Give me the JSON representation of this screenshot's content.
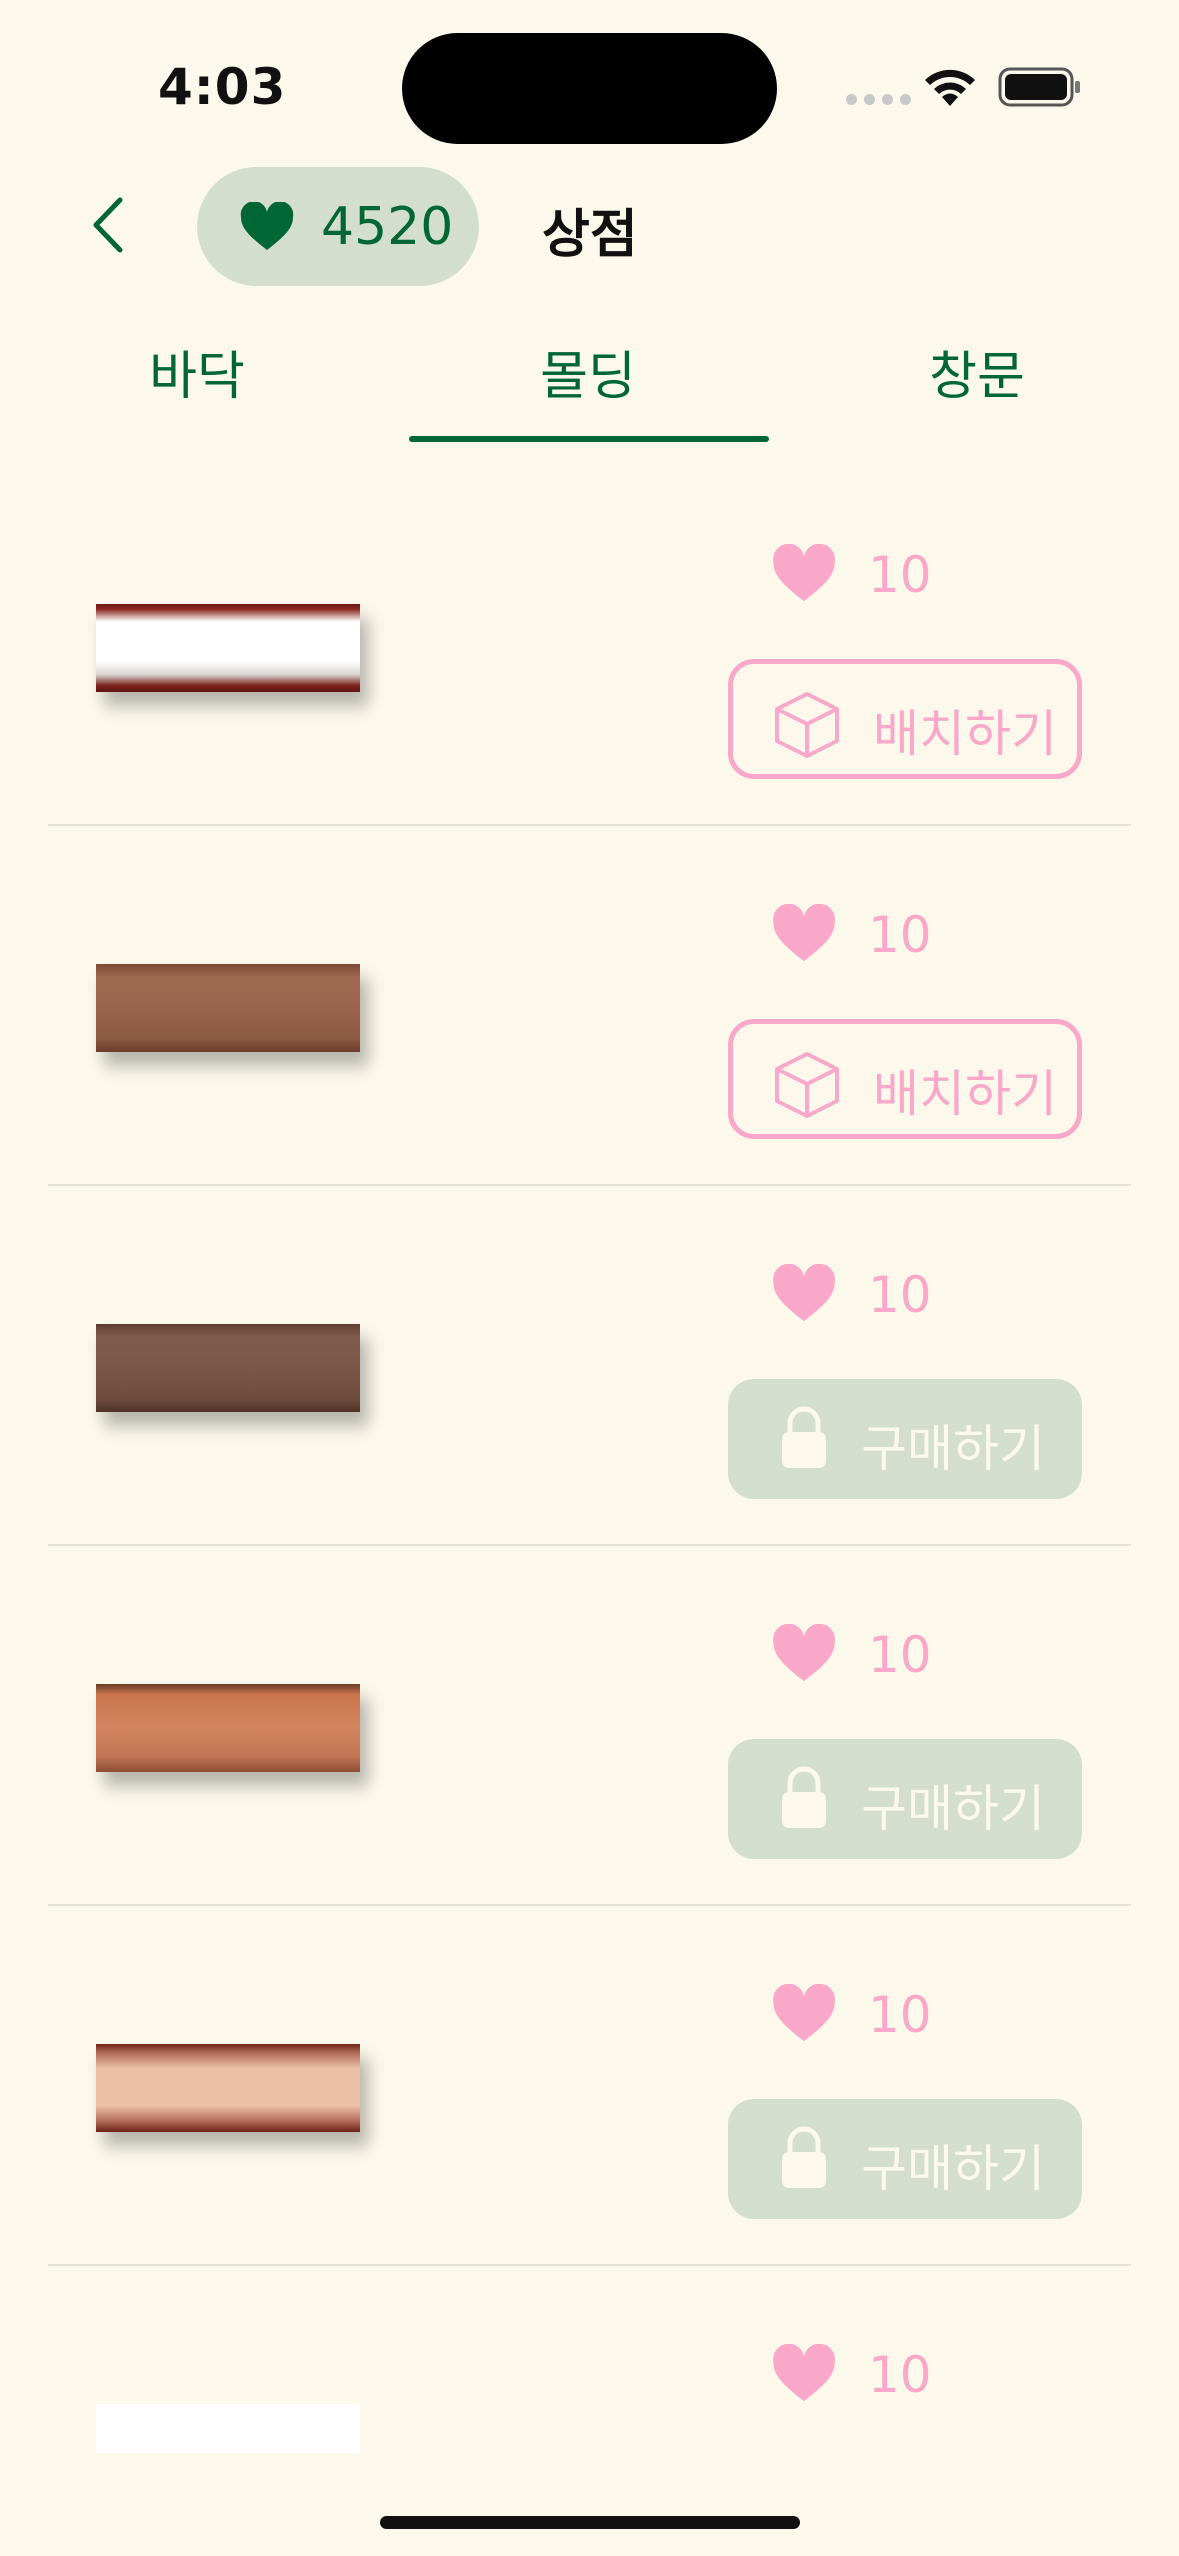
{
  "status_bar": {
    "time": "4:03"
  },
  "header": {
    "likes_count": "4520",
    "title": "상점"
  },
  "tabs": [
    {
      "label": "바닥",
      "selected": false
    },
    {
      "label": "몰딩",
      "selected": true
    },
    {
      "label": "창문",
      "selected": false
    }
  ],
  "colors": {
    "accent": "#006633",
    "pink": "#f9a8c9",
    "pill": "#d3dece",
    "background": "#fcf8ec"
  },
  "items": [
    {
      "price": "10",
      "action": "배치하기",
      "state": "owned",
      "swatch_color": "#ffffff"
    },
    {
      "price": "10",
      "action": "배치하기",
      "state": "owned",
      "swatch_color": "#9a644c"
    },
    {
      "price": "10",
      "action": "구매하기",
      "state": "locked",
      "swatch_color": "#7b5747"
    },
    {
      "price": "10",
      "action": "구매하기",
      "state": "locked",
      "swatch_color": "#d3845f"
    },
    {
      "price": "10",
      "action": "구매하기",
      "state": "locked",
      "swatch_color": "#ecc0a6"
    },
    {
      "price": "10",
      "action": "",
      "state": "unknown",
      "swatch_color": "#ffffff"
    }
  ]
}
